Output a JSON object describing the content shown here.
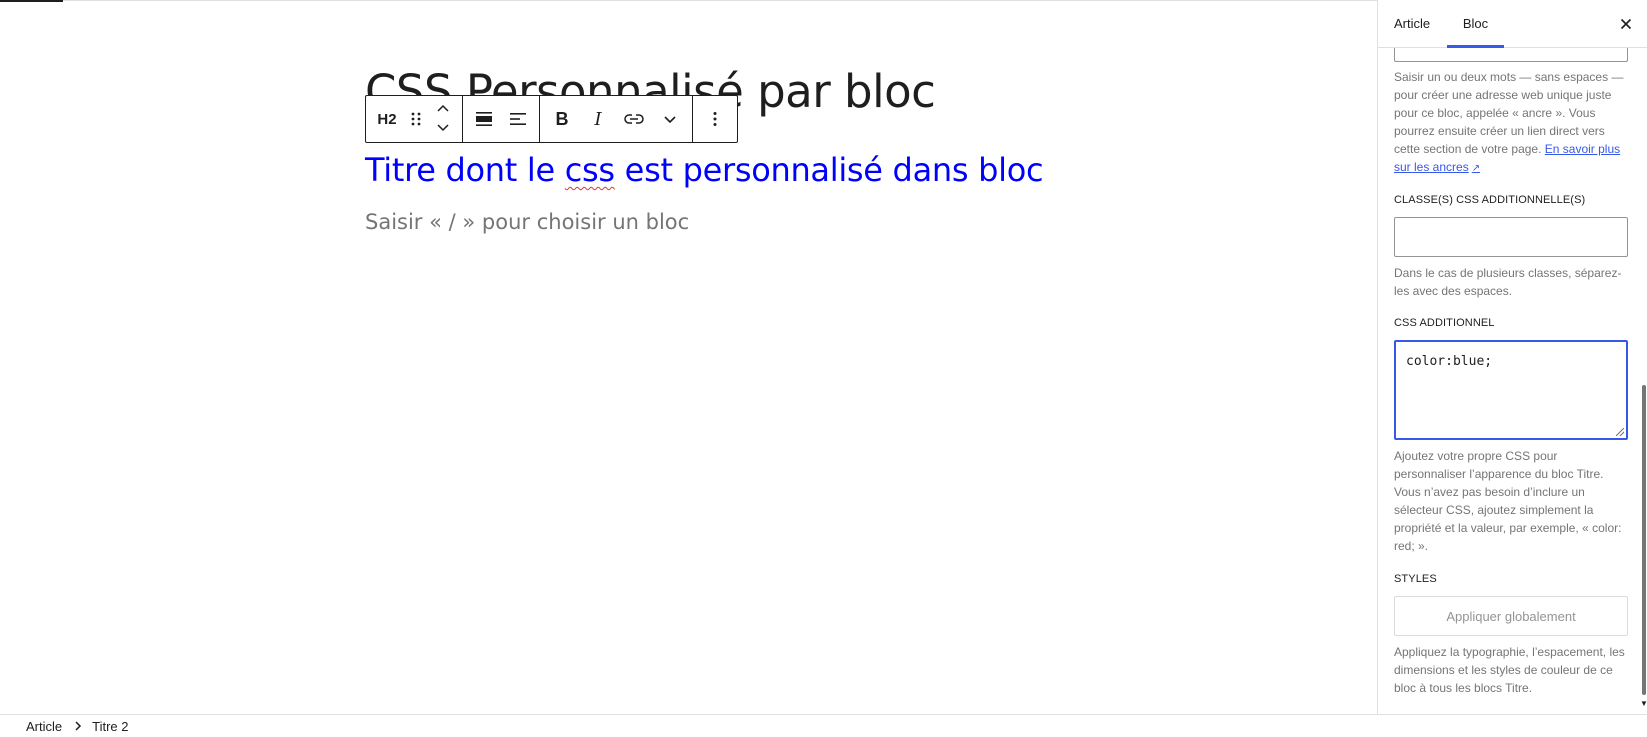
{
  "editor": {
    "post_title": "CSS Personnalisé par bloc",
    "heading_text_before": "Titre dont le ",
    "heading_text_spell": "css",
    "heading_text_after": " est personnalisé dans bloc",
    "heading_color": "#0000ff",
    "paragraph_placeholder": "Saisir « / » pour choisir un bloc"
  },
  "block_toolbar": {
    "block_type_label": "H2",
    "icons": {
      "drag": "drag-handle-icon",
      "move_up": "chevron-up-icon",
      "move_down": "chevron-down-icon",
      "align": "align-wide-icon",
      "text_align": "text-align-left-icon",
      "bold": "bold-icon",
      "italic": "italic-icon",
      "link": "link-icon",
      "more_rich_text": "chevron-down-icon",
      "options": "more-vertical-icon"
    },
    "bold_glyph": "B",
    "italic_glyph": "I"
  },
  "sidebar": {
    "tabs": [
      {
        "label": "Article",
        "active": false
      },
      {
        "label": "Bloc",
        "active": true
      }
    ],
    "close_icon": "close-icon",
    "anchor_help_text": "Saisir un ou deux mots — sans espaces — pour créer une adresse web unique juste pour ce bloc, appelée « ancre ». Vous pourrez ensuite créer un lien direct vers cette section de votre page.",
    "anchor_help_link": "En savoir plus sur les ancres",
    "anchor_help_link_arrow": "↗",
    "css_classes_label": "CLASSE(S) CSS ADDITIONNELLE(S)",
    "css_classes_value": "",
    "css_classes_help": "Dans le cas de plusieurs classes, séparez-les avec des espaces.",
    "additional_css_label": "CSS ADDITIONNEL",
    "additional_css_value": "color:blue;",
    "additional_css_help": "Ajoutez votre propre CSS pour personnaliser l’apparence du bloc Titre. Vous n’avez pas besoin d’inclure un sélecteur CSS, ajoutez simplement la propriété et la valeur, par exemple, « color: red; ».",
    "styles_label": "STYLES",
    "apply_globally_label": "Appliquer globalement",
    "styles_help": "Appliquez la typographie, l’espacement, les dimensions et les styles de couleur de ce bloc à tous les blocs Titre.",
    "accent_color": "#3858e9"
  },
  "breadcrumb": {
    "items": [
      "Article",
      "Titre 2"
    ],
    "separator_icon": "chevron-right-icon"
  }
}
